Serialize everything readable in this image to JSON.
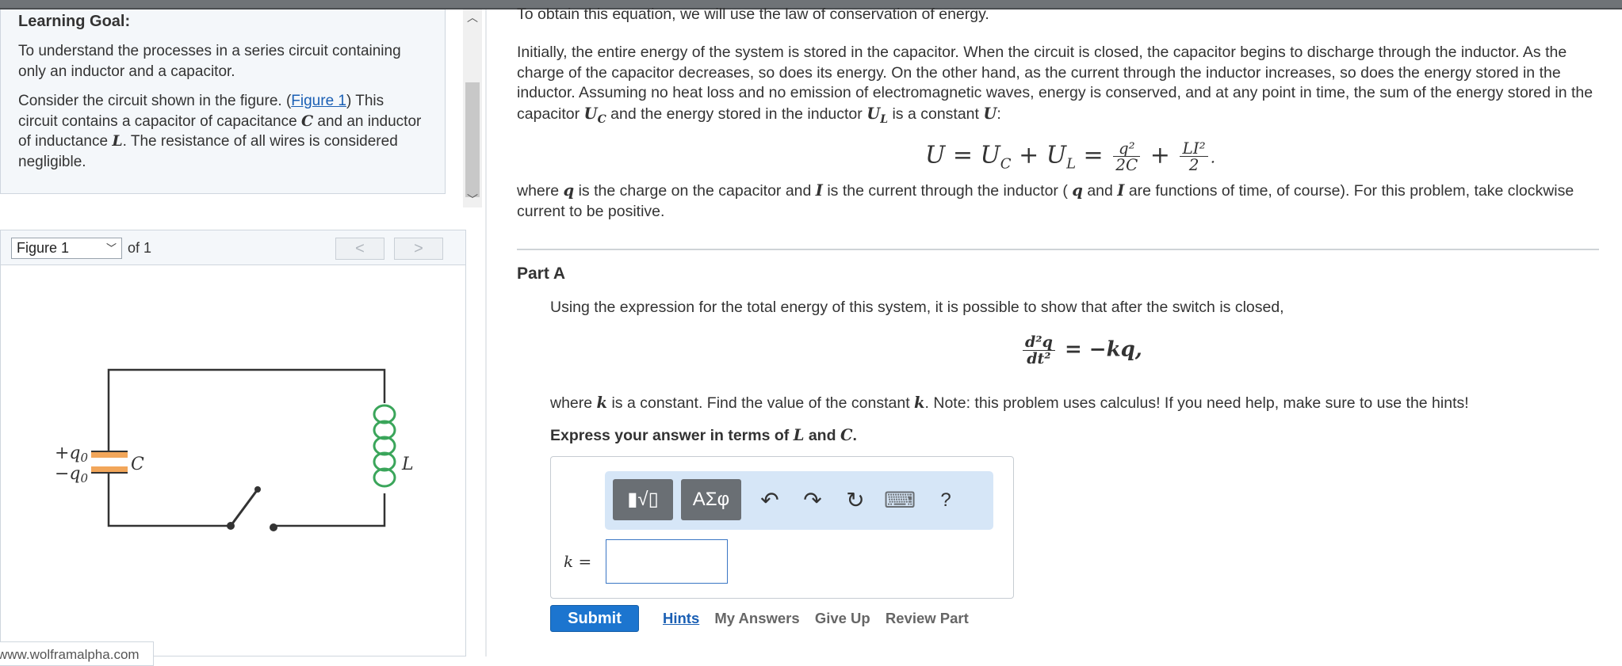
{
  "goal": {
    "title": "Learning Goal:",
    "intro": "To understand the processes in a series circuit containing only an inductor and a capacitor.",
    "p2_a": "Consider the circuit shown in the figure. (",
    "p2_link": "Figure 1",
    "p2_b": ") This circuit contains a capacitor of capacitance ",
    "p2_c": " and an inductor of inductance ",
    "p2_d": ". The resistance of all wires is considered negligible.",
    "sym_C": "C",
    "sym_L": "L"
  },
  "figure": {
    "select_value": "Figure 1",
    "of_text": "of 1",
    "prev": "<",
    "next": ">",
    "label_plus_q": "+q",
    "label_minus_q": "−q",
    "label_sub": "0",
    "label_C": "C",
    "label_L": "L",
    "source": "www.wolframalpha.com",
    "capacitor_color": "#f2a65a",
    "inductor_color": "#3aa55a"
  },
  "content": {
    "top_cut": "To obtain this equation, we will use the law of conservation of energy.",
    "para1_a": "Initially, the entire energy of the system is stored in the capacitor. When the circuit is closed, the capacitor begins to discharge through the inductor. As the charge of the capacitor decreases, so does its energy. On the other hand, as the current through the inductor increases, so does the energy stored in the inductor. Assuming no heat loss and no emission of electromagnetic waves, energy is conserved, and at any point in time, the sum of the energy stored in the capacitor ",
    "para1_UC": "U",
    "para1_b": " and the energy stored in the inductor ",
    "para1_c": " is a constant ",
    "para1_d": ":",
    "eq1_lhs": "U = U",
    "eq1_plus": " + U",
    "eq1_eq": " = ",
    "eq1_f1_num": "q²",
    "eq1_f1_den": "2C",
    "eq1_plus2": " + ",
    "eq1_f2_num": "LI²",
    "eq1_f2_den": "2",
    "para2_a": "where ",
    "para2_q": "q",
    "para2_b": " is the charge on the capacitor and ",
    "para2_I": "I",
    "para2_c": " is the current through the inductor ( ",
    "para2_d": " and ",
    "para2_e": " are functions of time, of course). For this problem, take clockwise current to be positive.",
    "part_title": "Part A",
    "partA_text": "Using the expression for the total energy of this system, it is possible to show that after the switch is closed,",
    "eq2_num": "d²q",
    "eq2_den": "dt²",
    "eq2_rhs": "= −kq,",
    "partA_find_a": "where ",
    "partA_find_k": "k",
    "partA_find_b": " is a constant. Find the value of the constant ",
    "partA_find_c": ". Note: this problem uses calculus! If you need help, make sure to use the hints!",
    "express_a": "Express your answer in terms of ",
    "express_b": " and ",
    "express_c": "."
  },
  "answer": {
    "tool_templates": "▮√▯",
    "tool_greek": "ΑΣφ",
    "tool_undo": "↶",
    "tool_redo": "↷",
    "tool_reset": "↻",
    "tool_keyboard": "⌨",
    "tool_help": "?",
    "k_label": "k =",
    "input_value": ""
  },
  "actions": {
    "submit": "Submit",
    "hints": "Hints",
    "my_answers": "My Answers",
    "give_up": "Give Up",
    "review_part": "Review Part"
  }
}
